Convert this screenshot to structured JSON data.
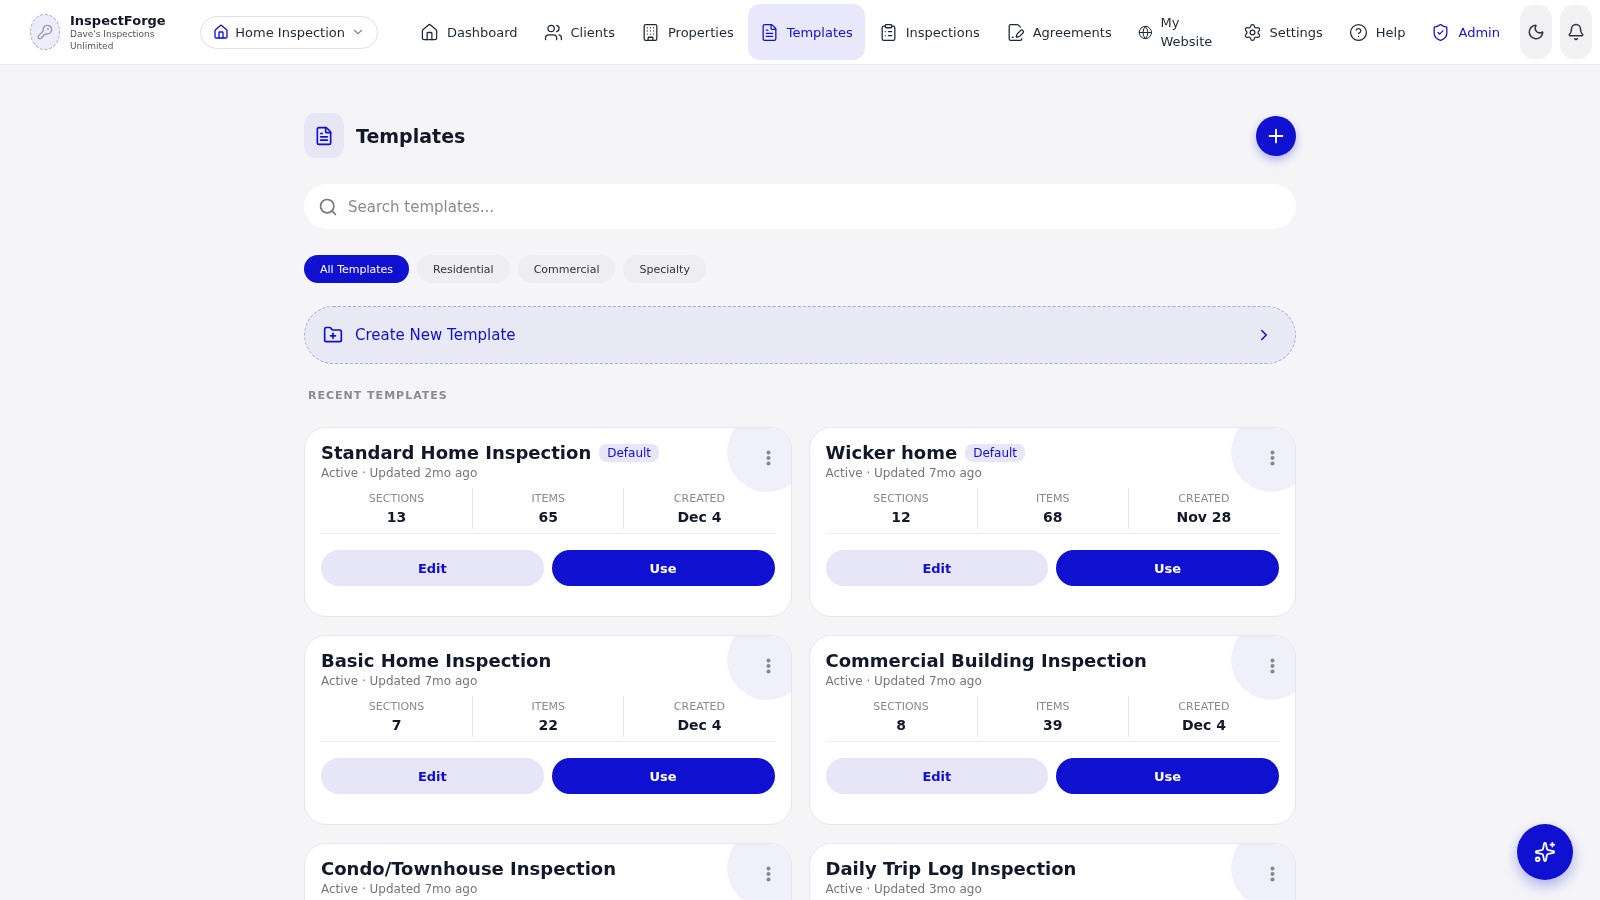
{
  "brand": {
    "name": "InspectForge",
    "company": "Dave's Inspections Unlimited"
  },
  "workspace": {
    "label": "Home Inspection"
  },
  "nav": [
    {
      "label": "Dashboard",
      "kind": "link",
      "selected": false
    },
    {
      "label": "Clients",
      "kind": "link",
      "selected": false
    },
    {
      "label": "Properties",
      "kind": "link",
      "selected": false
    },
    {
      "label": "Templates",
      "kind": "link",
      "selected": true
    },
    {
      "label": "Inspections",
      "kind": "link",
      "selected": false
    },
    {
      "label": "Agreements",
      "kind": "link",
      "selected": false
    },
    {
      "label": "My Website",
      "kind": "link",
      "selected": false
    },
    {
      "label": "Settings",
      "kind": "link",
      "selected": false
    },
    {
      "label": "Help",
      "kind": "link",
      "selected": false
    },
    {
      "label": "Admin",
      "kind": "admin",
      "selected": false
    }
  ],
  "page": {
    "title": "Templates"
  },
  "search": {
    "placeholder": "Search templates..."
  },
  "filters": [
    {
      "label": "All Templates",
      "selected": true
    },
    {
      "label": "Residential",
      "selected": false
    },
    {
      "label": "Commercial",
      "selected": false
    },
    {
      "label": "Specialty",
      "selected": false
    }
  ],
  "create": {
    "label": "Create New Template"
  },
  "section_label": "RECENT TEMPLATES",
  "templates": [
    {
      "title": "Standard Home Inspection",
      "badge": "Default",
      "status": "Active · Updated 2mo ago",
      "stats": [
        {
          "label": "SECTIONS",
          "value": "13"
        },
        {
          "label": "ITEMS",
          "value": "65"
        },
        {
          "label": "CREATED",
          "value": "Dec 4"
        }
      ],
      "actions": [
        "Edit",
        "Use"
      ]
    },
    {
      "title": "Wicker home",
      "badge": "Default",
      "status": "Active · Updated 7mo ago",
      "stats": [
        {
          "label": "SECTIONS",
          "value": "12"
        },
        {
          "label": "ITEMS",
          "value": "68"
        },
        {
          "label": "CREATED",
          "value": "Nov 28"
        }
      ],
      "actions": [
        "Edit",
        "Use"
      ]
    },
    {
      "title": "Basic Home Inspection",
      "status": "Active · Updated 7mo ago",
      "stats": [
        {
          "label": "SECTIONS",
          "value": "7"
        },
        {
          "label": "ITEMS",
          "value": "22"
        },
        {
          "label": "CREATED",
          "value": "Dec 4"
        }
      ],
      "actions": [
        "Edit",
        "Use"
      ]
    },
    {
      "title": "Commercial Building Inspection",
      "status": "Active · Updated 7mo ago",
      "stats": [
        {
          "label": "SECTIONS",
          "value": "8"
        },
        {
          "label": "ITEMS",
          "value": "39"
        },
        {
          "label": "CREATED",
          "value": "Dec 4"
        }
      ],
      "actions": [
        "Edit",
        "Use"
      ]
    },
    {
      "title": "Condo/Townhouse Inspection",
      "status": "Active · Updated 7mo ago"
    },
    {
      "title": "Daily Trip Log Inspection",
      "status": "Active · Updated 3mo ago"
    }
  ]
}
